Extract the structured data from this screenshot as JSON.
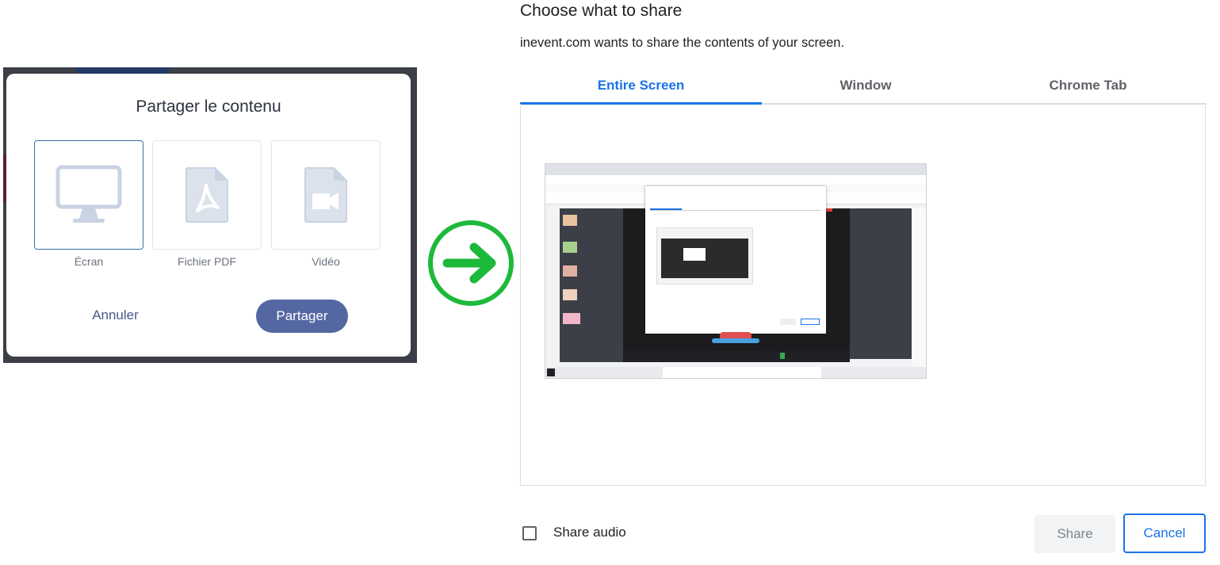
{
  "share_dialog": {
    "title": "Partager le contenu",
    "options": [
      {
        "label": "Écran",
        "icon": "monitor-icon",
        "selected": true
      },
      {
        "label": "Fichier PDF",
        "icon": "pdf-file-icon",
        "selected": false
      },
      {
        "label": "Vidéo",
        "icon": "video-file-icon",
        "selected": false
      }
    ],
    "cancel_label": "Annuler",
    "share_label": "Partager",
    "colors": {
      "primary": "#5567a3",
      "icon": "#c9d3e2",
      "selected_border": "#3a6fb0"
    }
  },
  "arrow": {
    "icon": "arrow-right-circle-icon",
    "color": "#1db93b"
  },
  "picker": {
    "title": "Choose what to share",
    "subtitle": "inevent.com wants to share the contents of your screen.",
    "tabs": [
      {
        "label": "Entire Screen",
        "active": true
      },
      {
        "label": "Window",
        "active": false
      },
      {
        "label": "Chrome Tab",
        "active": false
      }
    ],
    "preview": {
      "icon": "screen-thumbnail"
    },
    "share_audio_label": "Share audio",
    "share_audio_checked": false,
    "share_label": "Share",
    "cancel_label": "Cancel",
    "colors": {
      "accent": "#1a73e8",
      "disabled_bg": "#f1f3f4"
    }
  }
}
